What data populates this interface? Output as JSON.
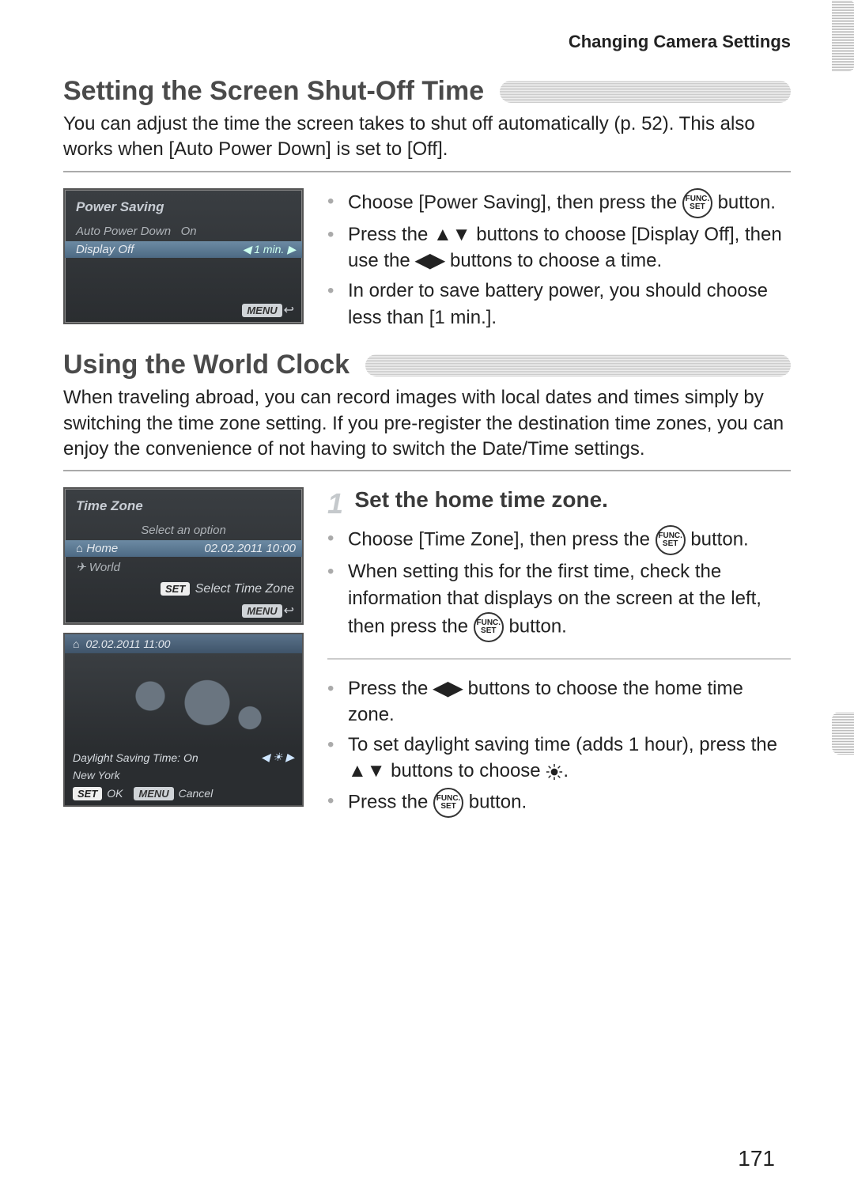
{
  "header": {
    "title": "Changing Camera Settings"
  },
  "page_number": "171",
  "func_button": {
    "top": "FUNC.",
    "bottom": "SET"
  },
  "section1": {
    "title": "Setting the Screen Shut-Off Time",
    "intro": "You can adjust the time the screen takes to shut off automatically (p. 52). This also works when [Auto Power Down] is set to [Off].",
    "lcd": {
      "title": "Power Saving",
      "row1_label": "Auto Power Down",
      "row1_value": "On",
      "row2_label": "Display Off",
      "row2_value": "1 min.",
      "footer_badge": "MENU",
      "footer_icon": "↩"
    },
    "bullets": {
      "b1a": "Choose [Power Saving], then press the ",
      "b1b": " button.",
      "b2a": "Press the ",
      "b2_arrows": "▲▼",
      "b2b": " buttons to choose [Display Off], then use the ",
      "b2_arrows2": "◀▶",
      "b2c": " buttons to choose a time.",
      "b3": "In order to save battery power, you should choose less than [1 min.]."
    }
  },
  "section2": {
    "title": "Using the World Clock",
    "intro": "When traveling abroad, you can record images with local dates and times simply by switching the time zone setting. If you pre-register the destination time zones, you can enjoy the convenience of not having to switch the Date/Time settings.",
    "step1": {
      "title": "Set the home time zone.",
      "b1a": "Choose [Time Zone], then press the ",
      "b1b": " button.",
      "b2a": "When setting this for the first time, check the information that displays on the screen at the left, then press the ",
      "b2b": " button.",
      "b3a": "Press the ",
      "b3_arrows": "◀▶",
      "b3b": " buttons to choose the home time zone.",
      "b4a": "To set daylight saving time (adds 1 hour), press the ",
      "b4_arrows": "▲▼",
      "b4b": " buttons to choose ",
      "b4c": ".",
      "b5a": "Press the ",
      "b5b": " button."
    },
    "lcd1": {
      "title": "Time Zone",
      "subtitle": "Select an option",
      "home_label": "Home",
      "home_value": "02.02.2011 10:00",
      "world_label": "World",
      "hint_badge": "SET",
      "hint_text": "Select Time Zone",
      "footer_badge": "MENU",
      "footer_icon": "↩"
    },
    "lcd2": {
      "top_date": "02.02.2011 11:00",
      "dst_label": "Daylight Saving Time:",
      "dst_value": "On",
      "city": "New York",
      "ok_badge": "SET",
      "ok_text": "OK",
      "cancel_badge": "MENU",
      "cancel_text": "Cancel"
    }
  }
}
